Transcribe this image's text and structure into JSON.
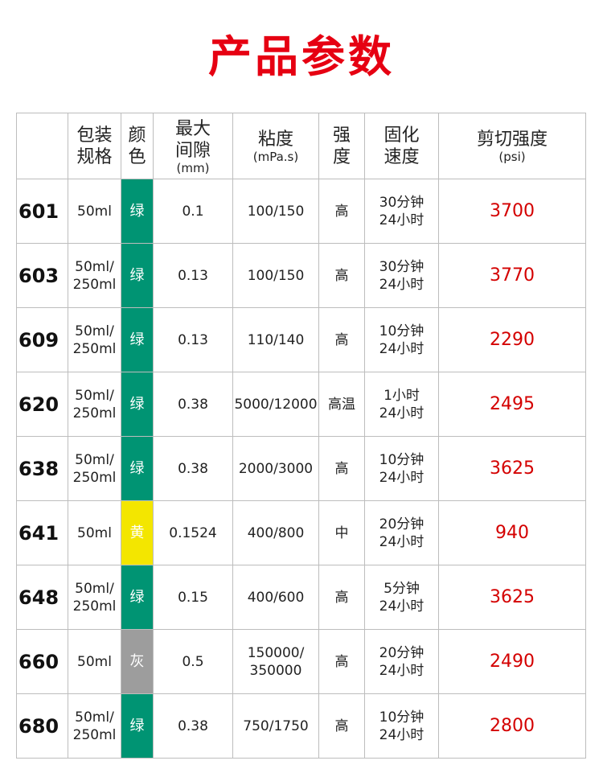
{
  "page_title": "产品参数",
  "colors": {
    "title_red": "#e60012",
    "value_red": "#d40000",
    "green": "#009473",
    "yellow": "#f3e600",
    "gray": "#9d9d9d"
  },
  "header": {
    "model": "",
    "package": [
      "包装",
      "规格"
    ],
    "color": [
      "颜",
      "色"
    ],
    "gap": [
      "最大",
      "间隙"
    ],
    "gap_unit": "(mm)",
    "viscosity": "粘度",
    "viscosity_unit": "(mPa.s)",
    "strength": [
      "强",
      "度"
    ],
    "cure": [
      "固化",
      "速度"
    ],
    "shear": "剪切强度",
    "shear_unit": "(psi)"
  },
  "rows": [
    {
      "model": "601",
      "package": [
        "50ml"
      ],
      "color": "绿",
      "swatch": "#009473",
      "gap": "0.1",
      "viscosity": [
        "100/150"
      ],
      "strength": "高",
      "cure": [
        "30分钟",
        "24小时"
      ],
      "shear": "3700"
    },
    {
      "model": "603",
      "package": [
        "50ml/",
        "250ml"
      ],
      "color": "绿",
      "swatch": "#009473",
      "gap": "0.13",
      "viscosity": [
        "100/150"
      ],
      "strength": "高",
      "cure": [
        "30分钟",
        "24小时"
      ],
      "shear": "3770"
    },
    {
      "model": "609",
      "package": [
        "50ml/",
        "250ml"
      ],
      "color": "绿",
      "swatch": "#009473",
      "gap": "0.13",
      "viscosity": [
        "110/140"
      ],
      "strength": "高",
      "cure": [
        "10分钟",
        "24小时"
      ],
      "shear": "2290"
    },
    {
      "model": "620",
      "package": [
        "50ml/",
        "250ml"
      ],
      "color": "绿",
      "swatch": "#009473",
      "gap": "0.38",
      "viscosity": [
        "5000/12000"
      ],
      "strength": "高温",
      "cure": [
        "1小时",
        "24小时"
      ],
      "shear": "2495"
    },
    {
      "model": "638",
      "package": [
        "50ml/",
        "250ml"
      ],
      "color": "绿",
      "swatch": "#009473",
      "gap": "0.38",
      "viscosity": [
        "2000/3000"
      ],
      "strength": "高",
      "cure": [
        "10分钟",
        "24小时"
      ],
      "shear": "3625"
    },
    {
      "model": "641",
      "package": [
        "50ml"
      ],
      "color": "黄",
      "swatch": "#f3e600",
      "gap": "0.1524",
      "viscosity": [
        "400/800"
      ],
      "strength": "中",
      "cure": [
        "20分钟",
        "24小时"
      ],
      "shear": "940"
    },
    {
      "model": "648",
      "package": [
        "50ml/",
        "250ml"
      ],
      "color": "绿",
      "swatch": "#009473",
      "gap": "0.15",
      "viscosity": [
        "400/600"
      ],
      "strength": "高",
      "cure": [
        "5分钟",
        "24小时"
      ],
      "shear": "3625"
    },
    {
      "model": "660",
      "package": [
        "50ml"
      ],
      "color": "灰",
      "swatch": "#9d9d9d",
      "gap": "0.5",
      "viscosity": [
        "150000/",
        "350000"
      ],
      "strength": "高",
      "cure": [
        "20分钟",
        "24小时"
      ],
      "shear": "2490"
    },
    {
      "model": "680",
      "package": [
        "50ml/",
        "250ml"
      ],
      "color": "绿",
      "swatch": "#009473",
      "gap": "0.38",
      "viscosity": [
        "750/1750"
      ],
      "strength": "高",
      "cure": [
        "10分钟",
        "24小时"
      ],
      "shear": "2800"
    }
  ]
}
